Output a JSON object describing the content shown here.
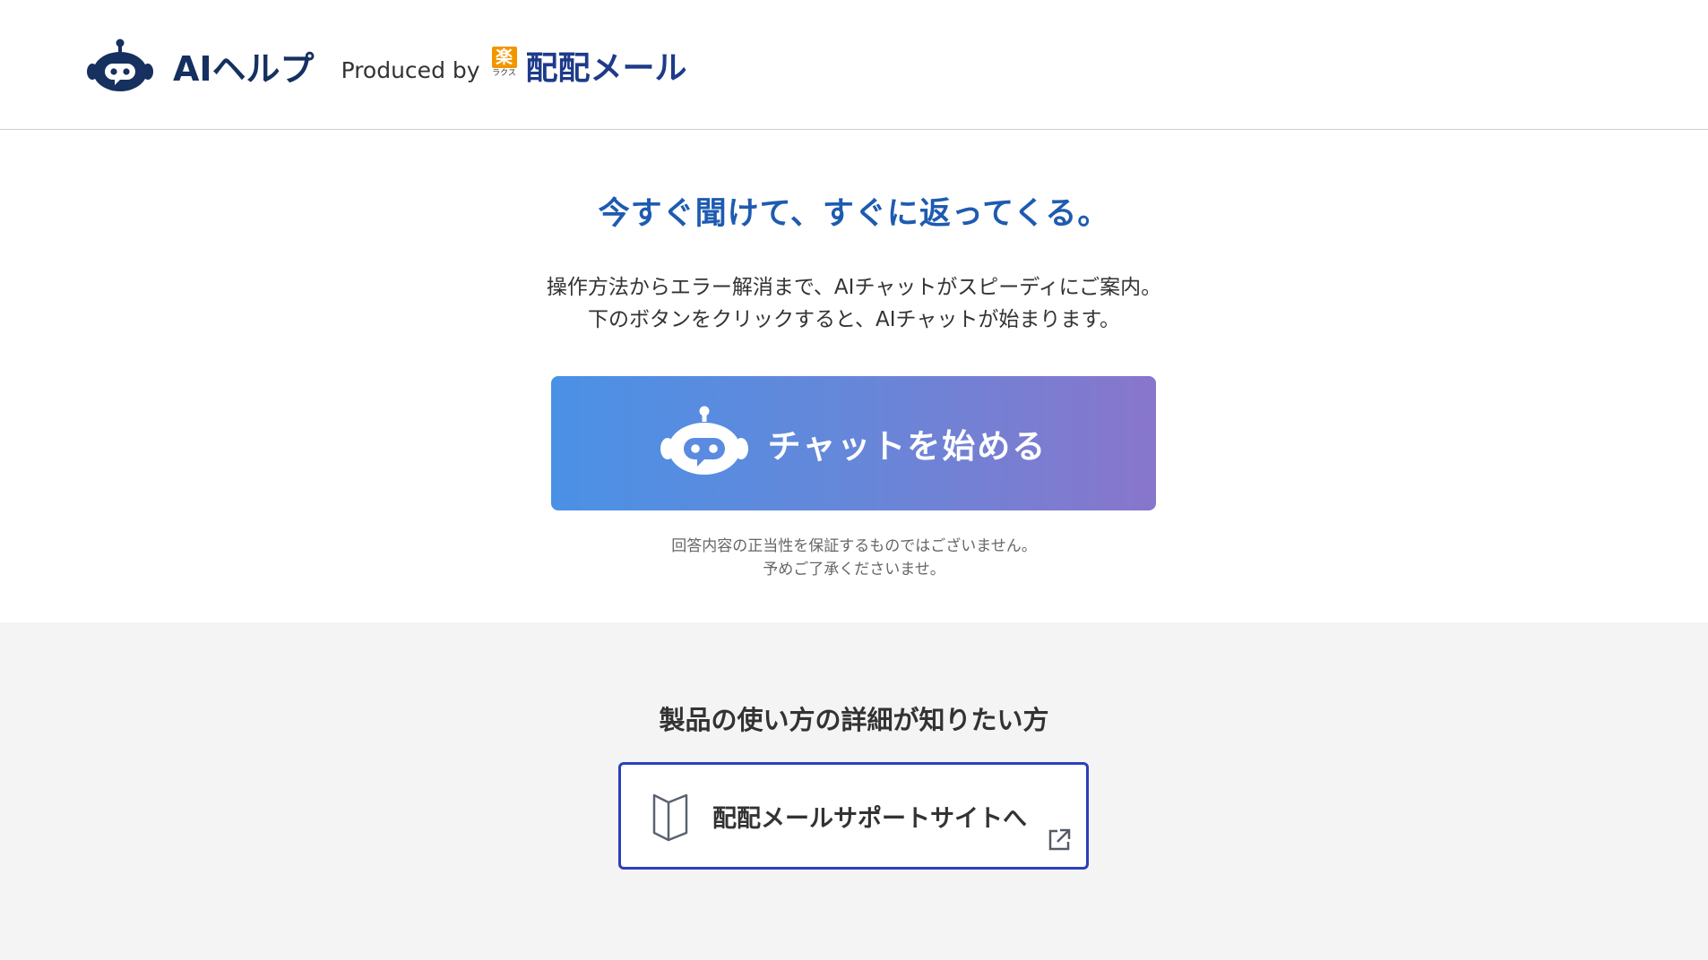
{
  "header": {
    "app_name": "AIヘルプ",
    "produced_by": "Produced by",
    "company_mark_top": "楽",
    "company_mark_bottom": "ラクス",
    "product_name": "配配メール",
    "brand_color": "#16305f"
  },
  "hero": {
    "headline": "今すぐ聞けて、すぐに返ってくる。",
    "description_lines": [
      "操作方法からエラー解消まで、AIチャットがスピーディにご案内。",
      "下のボタンをクリックすると、AIチャットが始まります。"
    ],
    "chat_button": {
      "label": "チャットを始める",
      "icon": "robot-chat-icon",
      "gradient_start": "#4a91e6",
      "gradient_end": "#8876cc"
    },
    "disclaimer_lines": [
      "回答内容の正当性を保証するものではございません。",
      "予めご了承くださいませ。"
    ],
    "headline_color": "#1e5bb0"
  },
  "support": {
    "title": "製品の使い方の詳細が知りたい方",
    "link_label": "配配メールサポートサイトへ",
    "link_icon": "book-icon",
    "external_icon": "external-link-icon",
    "border_color": "#2b3fbf",
    "background": "#f4f4f4"
  }
}
